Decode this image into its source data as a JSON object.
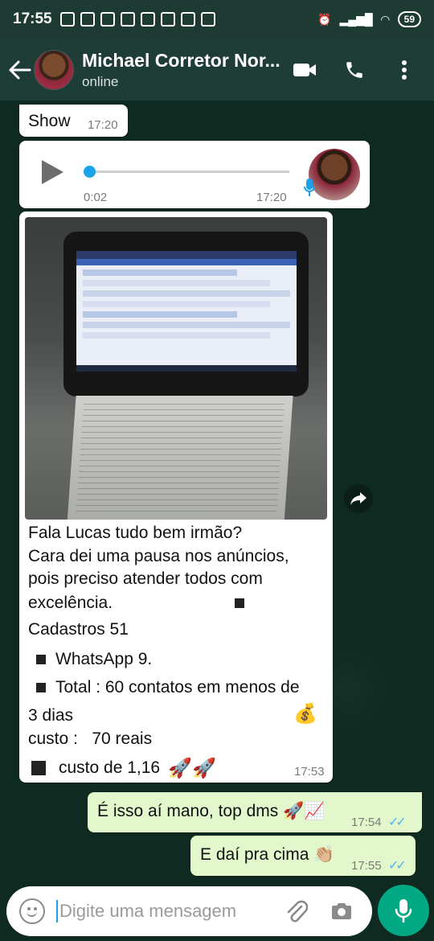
{
  "status_bar": {
    "time": "17:55",
    "battery": "59"
  },
  "header": {
    "contact_name": "Michael Corretor Nor...",
    "status": "online"
  },
  "messages": [
    {
      "type": "text",
      "direction": "in",
      "text": "Show",
      "time": "17:20"
    },
    {
      "type": "audio",
      "direction": "in",
      "duration": "0:02",
      "time": "17:20"
    },
    {
      "type": "image",
      "direction": "in",
      "caption_lines": [
        "Fala Lucas tudo bem irmão?",
        "Cara dei uma pausa nos anúncios,",
        "pois preciso atender todos com",
        "excelência.",
        "Cadastros 51",
        "WhatsApp 9.",
        "Total : 60 contatos em menos de",
        "3 dias",
        "custo :   70 reais",
        "custo de 1,16"
      ],
      "time": "17:53"
    },
    {
      "type": "text",
      "direction": "out",
      "text": "É isso aí mano, top dms 🚀📈",
      "time": "17:54"
    },
    {
      "type": "text",
      "direction": "out",
      "text": "E daí pra cima 👏🏼",
      "time": "17:55"
    }
  ],
  "composer": {
    "placeholder": "Digite uma mensagem"
  },
  "icons": {
    "back": "arrow-left-icon",
    "video": "video-call-icon",
    "phone": "voice-call-icon",
    "menu": "more-vert-icon",
    "emoji": "emoji-icon",
    "attach": "paperclip-icon",
    "camera": "camera-icon",
    "mic": "microphone-icon",
    "forward": "forward-icon"
  },
  "colors": {
    "header": "#1f3d37",
    "outgoing_bubble": "#e2f7cb",
    "incoming_bubble": "#ffffff",
    "accent": "#00a884",
    "read_ticks": "#4fb6ec"
  }
}
